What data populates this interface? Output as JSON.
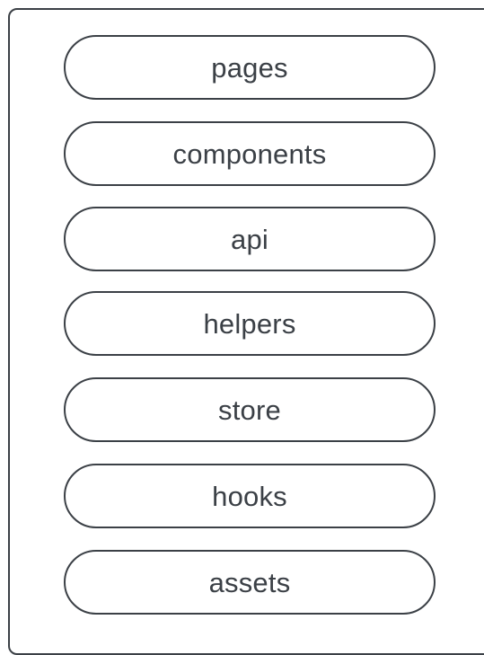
{
  "folders": [
    {
      "label": "pages"
    },
    {
      "label": "components"
    },
    {
      "label": "api"
    },
    {
      "label": "helpers"
    },
    {
      "label": "store"
    },
    {
      "label": "hooks"
    },
    {
      "label": "assets"
    }
  ],
  "colors": {
    "stroke": "#3b4046",
    "text": "#3b4046",
    "background": "#ffffff"
  }
}
